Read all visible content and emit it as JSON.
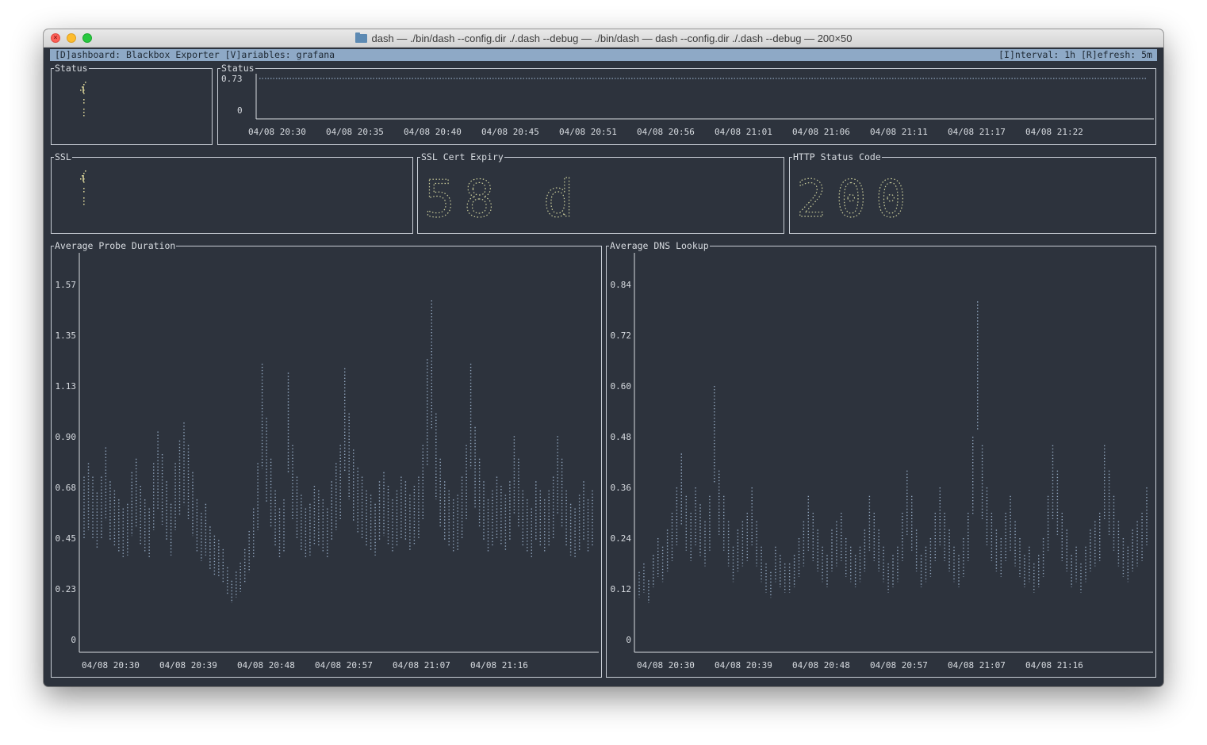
{
  "window": {
    "title": "dash — ./bin/dash --config.dir ./.dash --debug — ./bin/dash — dash --config.dir ./.dash --debug — 200×50",
    "close_glyph": "×"
  },
  "header": {
    "left": "[D]ashboard: Blackbox Exporter [V]ariables: grafana",
    "right": "[I]nterval: 1h [R]efresh: 5m"
  },
  "panels": {
    "status_single": {
      "title": "Status"
    },
    "status_chart": {
      "title": "Status"
    },
    "ssl": {
      "title": "SSL"
    },
    "ssl_expiry": {
      "title": "SSL Cert Expiry",
      "value": "58 d"
    },
    "http_status": {
      "title": "HTTP Status Code",
      "value": "200"
    },
    "probe_duration": {
      "title": "Average Probe Duration"
    },
    "dns_lookup": {
      "title": "Average DNS Lookup"
    }
  },
  "colors": {
    "background": "#2d333d",
    "text": "#d7dbe0",
    "header_bg": "#8ea9c6",
    "plot_dots": "#8ea3bb",
    "single_stat": "#d2cd95",
    "big_digits": "#c8cb9a"
  },
  "chart_data": [
    {
      "type": "line",
      "title": "Status",
      "x_ticks": [
        "04/08 20:30",
        "04/08 20:35",
        "04/08 20:40",
        "04/08 20:45",
        "04/08 20:51",
        "04/08 20:56",
        "04/08 21:01",
        "04/08 21:06",
        "04/08 21:11",
        "04/08 21:17",
        "04/08 21:22"
      ],
      "y_ticks": [
        "0.73",
        "0"
      ],
      "ylim": [
        0,
        0.73
      ],
      "series": [
        {
          "values": [
            0.73,
            0.73,
            0.73,
            0.73,
            0.73,
            0.73,
            0.73,
            0.73,
            0.73,
            0.73,
            0.73,
            0.73,
            0.73,
            0.73,
            0.73,
            0.73,
            0.73,
            0.73,
            0.73,
            0.73,
            0.73,
            0.73,
            0.73,
            0.73,
            0.73,
            0.73,
            0.73,
            0.73,
            0.73,
            0.73,
            0.73,
            0.73,
            0.73,
            0.73,
            0.73,
            0.73,
            0.73,
            0.73,
            0.73,
            0.73
          ]
        }
      ]
    },
    {
      "type": "scatter",
      "title": "Average Probe Duration",
      "x_ticks": [
        "04/08 20:30",
        "04/08 20:39",
        "04/08 20:48",
        "04/08 20:57",
        "04/08 21:07",
        "04/08 21:16"
      ],
      "y_ticks": [
        "1.57",
        "1.35",
        "1.13",
        "0.90",
        "0.68",
        "0.45",
        "0.23",
        "0"
      ],
      "ylim": [
        0,
        1.57
      ],
      "series": [
        {
          "values": [
            0.72,
            0.78,
            0.72,
            0.65,
            0.72,
            0.85,
            0.7,
            0.66,
            0.62,
            0.58,
            0.6,
            0.74,
            0.8,
            0.68,
            0.62,
            0.58,
            0.78,
            0.92,
            0.82,
            0.7,
            0.6,
            0.78,
            0.88,
            0.96,
            0.86,
            0.74,
            0.62,
            0.56,
            0.6,
            0.5,
            0.46,
            0.44,
            0.4,
            0.32,
            0.26,
            0.3,
            0.34,
            0.4,
            0.48,
            0.58,
            0.78,
            1.22,
            0.98,
            0.8,
            0.66,
            0.58,
            0.62,
            1.18,
            0.86,
            0.72,
            0.64,
            0.58,
            0.6,
            0.68,
            0.66,
            0.62,
            0.58,
            0.7,
            0.78,
            0.86,
            1.2,
            1.0,
            0.84,
            0.76,
            0.72,
            0.66,
            0.64,
            0.6,
            0.7,
            0.74,
            0.68,
            0.62,
            0.66,
            0.72,
            0.7,
            0.64,
            0.68,
            0.72,
            0.86,
            1.24,
            1.5,
            1.0,
            0.8,
            0.7,
            0.66,
            0.62,
            0.64,
            0.72,
            0.86,
            1.22,
            0.94,
            0.8,
            0.7,
            0.62,
            0.66,
            0.72,
            0.68,
            0.64,
            0.7,
            0.9,
            0.8,
            0.66,
            0.62,
            0.58,
            0.7,
            0.66,
            0.62,
            0.66,
            0.72,
            0.9,
            0.8,
            0.66,
            0.6,
            0.58,
            0.64,
            0.7,
            0.62,
            0.66
          ]
        }
      ]
    },
    {
      "type": "scatter",
      "title": "Average DNS Lookup",
      "x_ticks": [
        "04/08 20:30",
        "04/08 20:39",
        "04/08 20:48",
        "04/08 20:57",
        "04/08 21:07",
        "04/08 21:16"
      ],
      "y_ticks": [
        "0.84",
        "0.72",
        "0.60",
        "0.48",
        "0.36",
        "0.24",
        "0.12",
        "0"
      ],
      "ylim": [
        0,
        0.84
      ],
      "series": [
        {
          "values": [
            0.16,
            0.18,
            0.14,
            0.2,
            0.24,
            0.22,
            0.26,
            0.3,
            0.36,
            0.44,
            0.34,
            0.3,
            0.36,
            0.32,
            0.28,
            0.34,
            0.6,
            0.4,
            0.34,
            0.28,
            0.22,
            0.26,
            0.28,
            0.3,
            0.36,
            0.28,
            0.22,
            0.18,
            0.16,
            0.22,
            0.2,
            0.18,
            0.18,
            0.2,
            0.24,
            0.28,
            0.34,
            0.3,
            0.26,
            0.22,
            0.2,
            0.26,
            0.28,
            0.3,
            0.24,
            0.22,
            0.2,
            0.22,
            0.26,
            0.34,
            0.3,
            0.26,
            0.22,
            0.18,
            0.2,
            0.22,
            0.3,
            0.4,
            0.34,
            0.26,
            0.2,
            0.22,
            0.24,
            0.3,
            0.36,
            0.3,
            0.26,
            0.22,
            0.2,
            0.24,
            0.3,
            0.48,
            0.8,
            0.46,
            0.36,
            0.3,
            0.26,
            0.24,
            0.3,
            0.34,
            0.28,
            0.24,
            0.2,
            0.22,
            0.18,
            0.2,
            0.24,
            0.34,
            0.46,
            0.4,
            0.3,
            0.26,
            0.2,
            0.22,
            0.18,
            0.22,
            0.26,
            0.28,
            0.3,
            0.46,
            0.4,
            0.34,
            0.28,
            0.24,
            0.22,
            0.26,
            0.28,
            0.3,
            0.36
          ]
        }
      ]
    }
  ]
}
